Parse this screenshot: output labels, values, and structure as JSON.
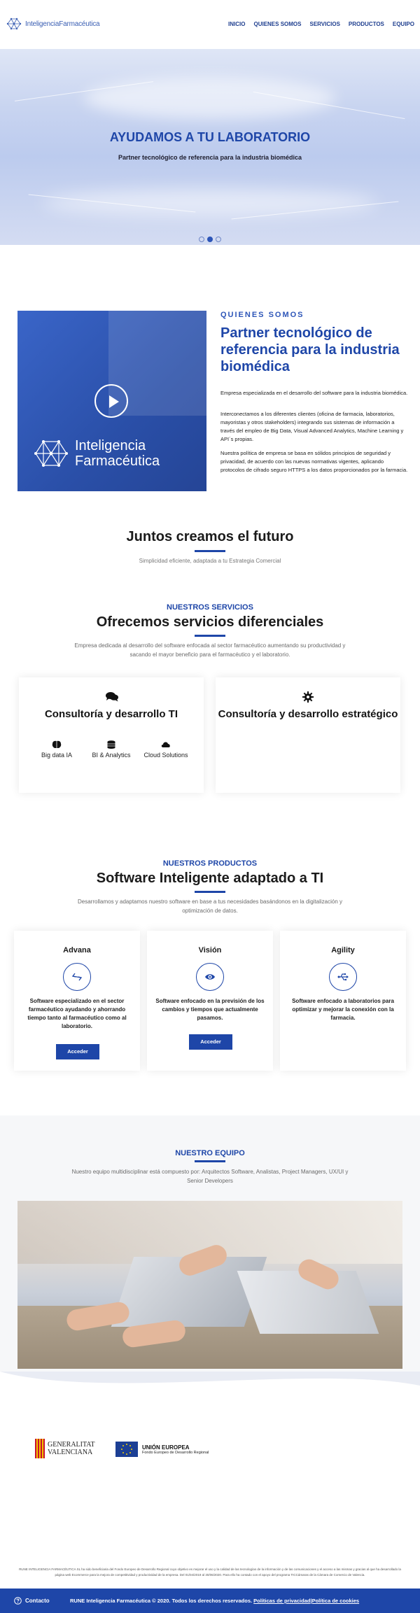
{
  "header": {
    "logo_part1": "Inteligencia",
    "logo_part2": "Farmacéutica",
    "nav": [
      "INICIO",
      "QUIENES SOMOS",
      "SERVICIOS",
      "PRODUCTOS",
      "EQUIPO"
    ]
  },
  "hero": {
    "title": "AYUDAMOS A TU LABORATORIO",
    "subtitle": "Partner tecnológico de referencia para la industria biomédica",
    "active_slide": 2,
    "slide_count": 3
  },
  "about": {
    "eyebrow": "QUIENES SOMOS",
    "title": "Partner tecnológico de referencia para la industria biomédica",
    "video_brand_line1": "Inteligencia",
    "video_brand_line2": "Farmacéutica",
    "paragraphs": [
      "Empresa especializada en el desarrollo del software para la industria biomédica.",
      "Interconectamos a los diferentes clientes  (oficina de farmacia, laboratorios, mayoristas y otros stakeholders) integrando sus sistemas de información a través del empleo de  Big Data, Visual Advanced Analytics, Machine Learning  y API´s propias.",
      "Nuestra política de empresa se basa en sólidos principios de seguridad y privacidad, de acuerdo con las nuevas normativas vigentes, aplicando protocolos de cifrado seguro HTTPS a los datos proporcionados por la farmacia."
    ]
  },
  "juntos": {
    "title": "Juntos creamos el futuro",
    "subtitle": "Simplicidad eficiente, adaptada a tu Estrategia Comercial"
  },
  "services": {
    "eyebrow": "NUESTROS SERVICIOS",
    "title": "Ofrecemos servicios diferenciales",
    "description": "Empresa dedicada al desarrollo del software enfocada al sector farmacéutico aumentando su productividad y sacando el mayor beneficio para el farmacéutico y el laboratorio.",
    "cards": [
      {
        "title": "Consultoría y desarrollo TI",
        "icon": "comments-icon",
        "items": [
          {
            "label": "Big data IA",
            "icon": "brain-icon"
          },
          {
            "label": "BI & Analytics",
            "icon": "database-icon"
          },
          {
            "label": "Cloud Solutions",
            "icon": "cloud-icon"
          }
        ]
      },
      {
        "title": "Consultoría y desarrollo estratégico",
        "icon": "cog-icon",
        "items": []
      }
    ]
  },
  "products": {
    "eyebrow": "NUESTROS PRODUCTOS",
    "title": "Software Inteligente adaptado a TI",
    "description": "Desarrollamos y adaptamos nuestro software en base a tus necesidades basándonos en la digitalización y optimización de datos.",
    "items": [
      {
        "name": "Advana",
        "icon": "arrows-icon",
        "description": "Software especializado en el sector farmacéutico ayudando y ahorrando tiempo tanto al farmacéutico como al laboratorio.",
        "button": "Acceder"
      },
      {
        "name": "Visión",
        "icon": "eye-icon",
        "description": "Software enfocado en la previsión de los cambios y tiempos que actualmente pasamos.",
        "button": "Acceder"
      },
      {
        "name": "Agility",
        "icon": "usb-icon",
        "description": "Software enfocado a laboratorios para optimizar y mejorar la conexión con la farmacia.",
        "button": ""
      }
    ]
  },
  "team": {
    "title": "NUESTRO EQUIPO",
    "description": "Nuestro equipo multidisciplinar está compuesto por: Arquitectos Software, Analistas, Project Managers, UX/UI y Senior Developers"
  },
  "logos": {
    "gva_line1": "GENERALITAT",
    "gva_line2": "VALENCIANA",
    "eu_title": "UNIÓN EUROPEA",
    "eu_sub": "Fondo Europeo de Desarrollo Regional"
  },
  "legal": "RUNE INTELIGENCIA FARMACÉUTICA SL ha sido beneficiaria del Fondo Europeo de Desarrollo Regional cuyo objetivo es mejorar el uso y la calidad de las tecnologías de la información y de las comunicaciones y el acceso a las mismas y gracias al que ha desarrollado la página web Ecommerce para la mejora de competitividad y productividad de la empresa. Del 01/04/2019 al 30/06/2020. Para ello ha contado con el apoyo del programa TICCámaras de la Cámara de Comercio de Valencia.",
  "footer": {
    "contact": "Contacto",
    "copyright": "RUNE Inteligencia Farmacéutica © 2020. Todos los derechos reservados.",
    "privacy": "Políticas de privacidad",
    "separator": "|",
    "cookies": "Política de cookies"
  },
  "colors": {
    "accent": "#1e46a8",
    "footer": "#1e46a8",
    "text": "#2b2b2b"
  }
}
